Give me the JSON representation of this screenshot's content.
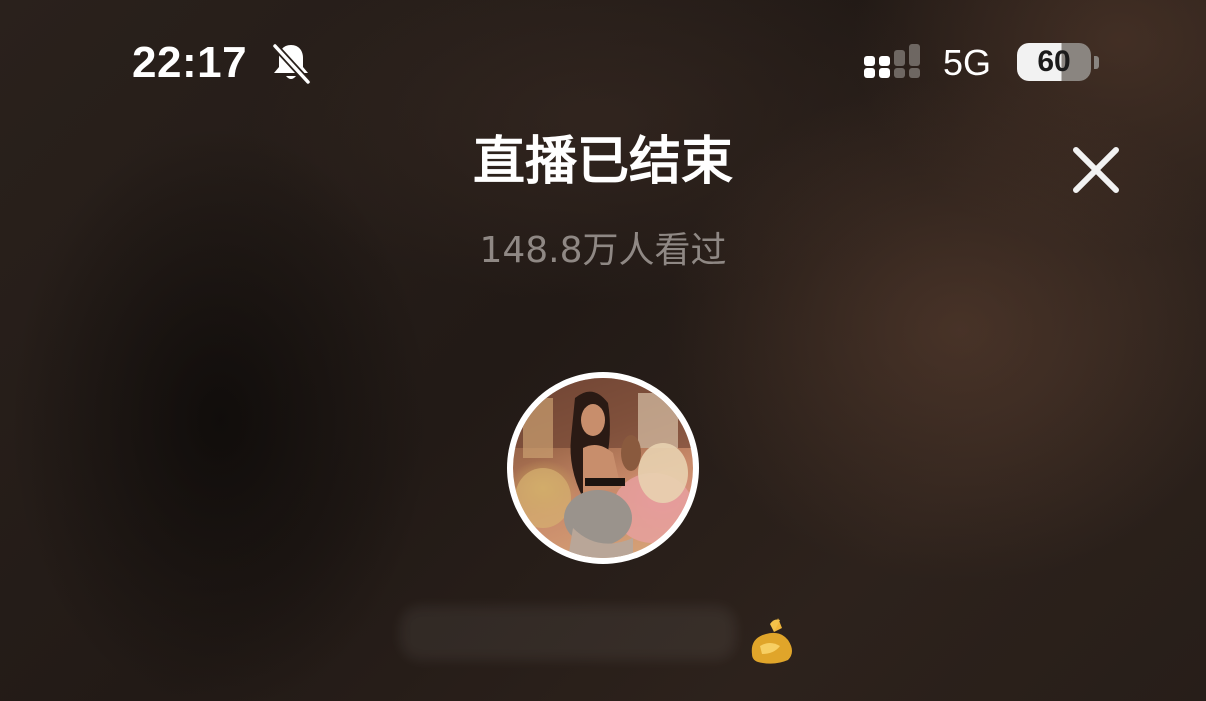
{
  "status_bar": {
    "time": "22:17",
    "silent_icon": "bell-slash-icon",
    "signal_icon": "signal-bars-icon",
    "signal_bars_filled": 2,
    "signal_bars_total": 4,
    "network": "5G",
    "battery_level": "60",
    "battery_fraction": 0.6
  },
  "header": {
    "title": "直播已结束",
    "viewer_count": "148.8万人看过",
    "close_icon": "close-icon"
  },
  "streamer": {
    "avatar_icon": "avatar",
    "name": "",
    "badge_icon": "gold-badge-icon"
  },
  "colors": {
    "background": "#221a16",
    "title_text": "#ffffff",
    "secondary_text": "#8f8884",
    "badge": "#e0a52a"
  }
}
